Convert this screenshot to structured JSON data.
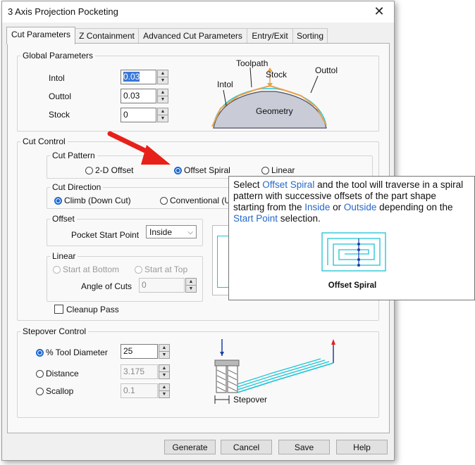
{
  "window": {
    "title": "3 Axis Projection Pocketing",
    "close_glyph": "✕"
  },
  "tabs": [
    {
      "label": "Cut Parameters",
      "active": true
    },
    {
      "label": "Z Containment"
    },
    {
      "label": "Advanced Cut Parameters"
    },
    {
      "label": "Entry/Exit"
    },
    {
      "label": "Sorting"
    }
  ],
  "global_parameters": {
    "legend": "Global Parameters",
    "intol": {
      "label": "Intol",
      "value": "0.03"
    },
    "outtol": {
      "label": "Outtol",
      "value": "0.03"
    },
    "stock": {
      "label": "Stock",
      "value": "0"
    },
    "diagram": {
      "toolpath": "Toolpath",
      "stock": "Stock",
      "intol": "Intol",
      "outtol": "Outtol",
      "geometry": "Geometry"
    }
  },
  "cut_control": {
    "legend": "Cut Control",
    "cut_pattern": {
      "legend": "Cut Pattern",
      "options": [
        "2-D Offset",
        "Offset Spiral",
        "Linear"
      ],
      "selected": "Offset Spiral"
    },
    "cut_direction": {
      "legend": "Cut Direction",
      "options": [
        "Climb (Down Cut)",
        "Conventional (U"
      ],
      "selected": "Climb (Down Cut)"
    },
    "offset": {
      "legend": "Offset",
      "pocket_start_label": "Pocket Start Point",
      "pocket_start_value": "Inside"
    },
    "linear": {
      "legend": "Linear",
      "start_bottom": "Start at Bottom",
      "start_top": "Start at Top",
      "angle_label": "Angle of Cuts",
      "angle_value": "0"
    },
    "cleanup_pass": {
      "label": "Cleanup Pass",
      "checked": false
    }
  },
  "stepover_control": {
    "legend": "Stepover Control",
    "options": [
      {
        "label": "% Tool Diameter",
        "value": "25",
        "selected": true
      },
      {
        "label": "Distance",
        "value": "3.175"
      },
      {
        "label": "Scallop",
        "value": "0.1"
      }
    ],
    "diagram_label": "Stepover"
  },
  "buttons": {
    "generate": "Generate",
    "cancel": "Cancel",
    "save": "Save",
    "help": "Help"
  },
  "tooltip": {
    "t1": "Select ",
    "k1": "Offset Spiral",
    "t2": " and the tool will traverse in a spiral pattern with successive offsets of the part shape starting from the ",
    "k2": "Inside",
    "t3": " or ",
    "k3": "Outside",
    "t4": " depending on the ",
    "k4": "Start Point",
    "t5": " selection.",
    "caption": "Offset Spiral"
  },
  "colors": {
    "accent": "#1a66d1",
    "tooltip_keyword": "#2468c8",
    "annotation_arrow": "#e8201a",
    "diagram_cyan": "#19c3d6"
  }
}
